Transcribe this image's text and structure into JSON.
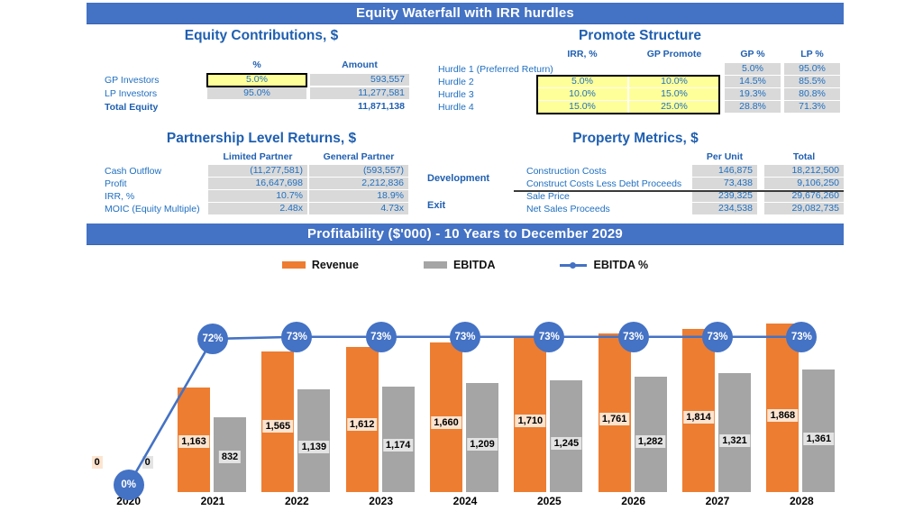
{
  "banners": {
    "top": "Equity Waterfall with IRR hurdles",
    "chart": "Profitability ($'000) - 10 Years to December 2029"
  },
  "equity_contributions": {
    "title": "Equity Contributions, $",
    "headers": [
      "%",
      "Amount"
    ],
    "rows": [
      {
        "label": "GP Investors",
        "pct": "5.0%",
        "amount": "593,557"
      },
      {
        "label": "LP Investors",
        "pct": "95.0%",
        "amount": "11,277,581"
      },
      {
        "label": "Total Equity",
        "pct": "",
        "amount": "11,871,138"
      }
    ]
  },
  "promote_structure": {
    "title": "Promote Structure",
    "headers": [
      "IRR, %",
      "GP Promote",
      "GP %",
      "LP %"
    ],
    "rows": [
      {
        "label": "Hurdle 1 (Preferred Return)",
        "irr": "",
        "promote": "",
        "gp": "5.0%",
        "lp": "95.0%"
      },
      {
        "label": "Hurdle 2",
        "irr": "5.0%",
        "promote": "10.0%",
        "gp": "14.5%",
        "lp": "85.5%"
      },
      {
        "label": "Hurdle 3",
        "irr": "10.0%",
        "promote": "15.0%",
        "gp": "19.3%",
        "lp": "80.8%"
      },
      {
        "label": "Hurdle 4",
        "irr": "15.0%",
        "promote": "25.0%",
        "gp": "28.8%",
        "lp": "71.3%"
      }
    ]
  },
  "partnership_returns": {
    "title": "Partnership Level Returns, $",
    "headers": [
      "Limited Partner",
      "General Partner"
    ],
    "rows": [
      {
        "label": "Cash Outflow",
        "lp": "(11,277,581)",
        "gp": "(593,557)"
      },
      {
        "label": "Profit",
        "lp": "16,647,698",
        "gp": "2,212,836"
      },
      {
        "label": "IRR, %",
        "lp": "10.7%",
        "gp": "18.9%"
      },
      {
        "label": "MOIC (Equity Multiple)",
        "lp": "2.48x",
        "gp": "4.73x"
      }
    ]
  },
  "property_metrics": {
    "title": "Property Metrics, $",
    "headers": [
      "Per Unit",
      "Total"
    ],
    "group_development": "Development",
    "group_exit": "Exit",
    "rows": [
      {
        "label": "Construction Costs",
        "per_unit": "146,875",
        "total": "18,212,500"
      },
      {
        "label": "Construct Costs Less Debt Proceeds",
        "per_unit": "73,438",
        "total": "9,106,250"
      },
      {
        "label": "Sale Price",
        "per_unit": "239,325",
        "total": "29,676,260"
      },
      {
        "label": "Net Sales Proceeds",
        "per_unit": "234,538",
        "total": "29,082,735"
      }
    ]
  },
  "chart_data": {
    "type": "bar",
    "title": "Profitability ($'000) - 10 Years to December 2029",
    "xlabel": "",
    "ylabel": "",
    "grid": false,
    "legend_position": "top",
    "categories": [
      "2020",
      "2021",
      "2022",
      "2023",
      "2024",
      "2025",
      "2026",
      "2027",
      "2028"
    ],
    "series": [
      {
        "name": "Revenue",
        "type": "bar",
        "color": "#ED7D31",
        "values": [
          0,
          1163,
          1565,
          1612,
          1660,
          1710,
          1761,
          1814,
          1868
        ],
        "labels": [
          "0",
          "1,163",
          "1,565",
          "1,612",
          "1,660",
          "1,710",
          "1,761",
          "1,814",
          "1,868"
        ]
      },
      {
        "name": "EBITDA",
        "type": "bar",
        "color": "#A5A5A5",
        "values": [
          0,
          832,
          1139,
          1174,
          1209,
          1245,
          1282,
          1321,
          1361
        ],
        "labels": [
          "0",
          "832",
          "1,139",
          "1,174",
          "1,209",
          "1,245",
          "1,282",
          "1,321",
          "1,361"
        ]
      },
      {
        "name": "EBITDA %",
        "type": "line",
        "color": "#4472C4",
        "values": [
          0,
          72,
          73,
          73,
          73,
          73,
          73,
          73,
          73
        ],
        "labels": [
          "0%",
          "72%",
          "73%",
          "73%",
          "73%",
          "73%",
          "73%",
          "73%",
          "73%"
        ]
      }
    ],
    "ylim": [
      0,
      2000
    ],
    "pct_ylim": [
      0,
      100
    ]
  },
  "colors": {
    "banner_blue": "#4472C4",
    "revenue_orange": "#ED7D31",
    "ebitda_gray": "#A5A5A5",
    "input_yellow": "#FFFF99",
    "cell_gray": "#D9D9D9",
    "text_blue": "#1F6FC0"
  }
}
